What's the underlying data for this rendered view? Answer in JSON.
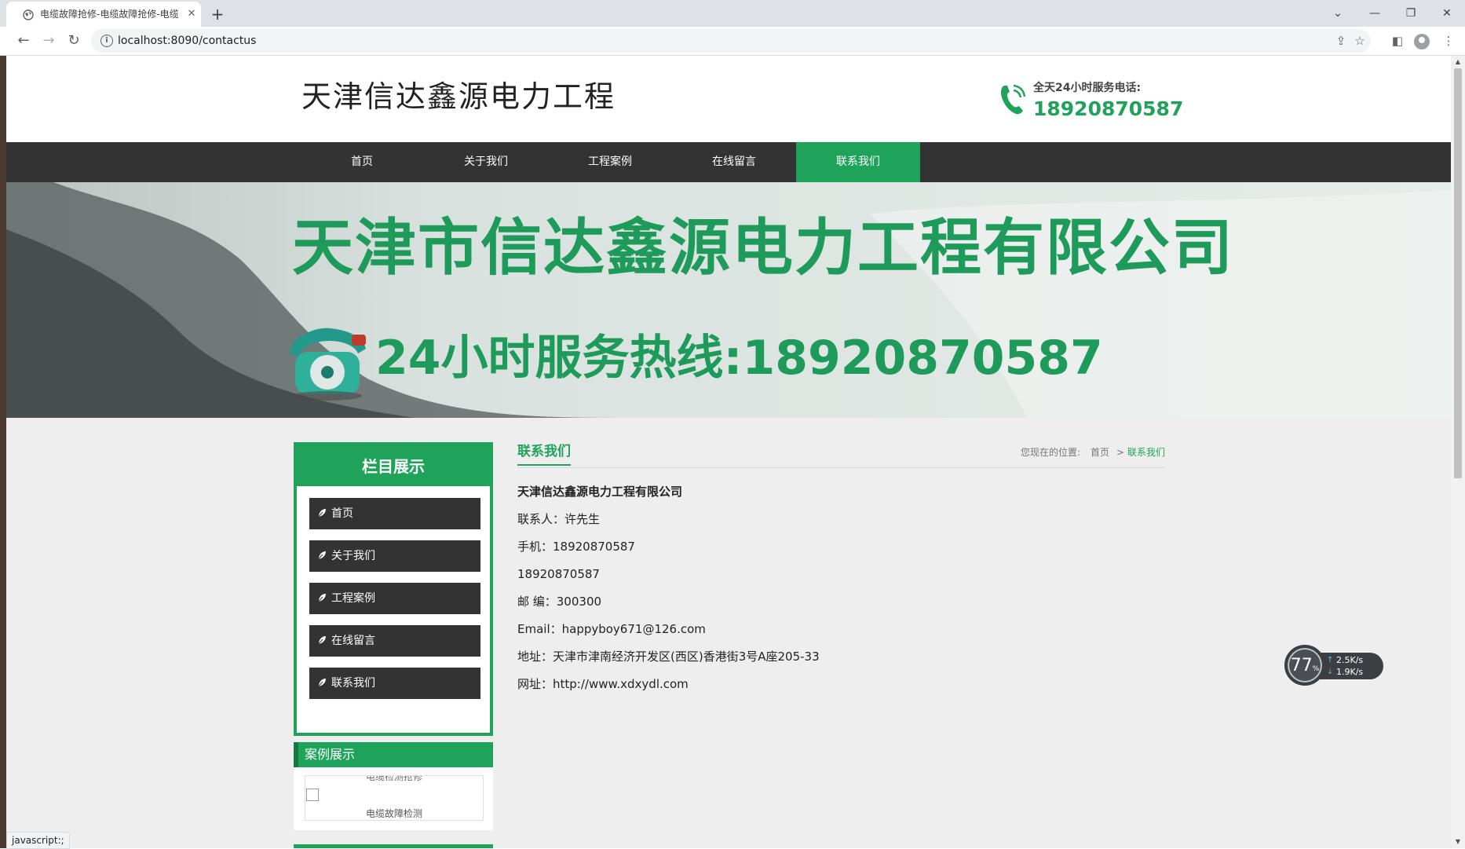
{
  "browser": {
    "tab_title": "电缆故障抢修-电缆故障抢修-电缆",
    "tab_close": "✕",
    "new_tab": "+",
    "url": "localhost:8090/contactus",
    "status_text": "javascript:;",
    "window_controls": {
      "dropdown": "⌄",
      "minimize": "—",
      "restore": "❐",
      "close": "✕"
    }
  },
  "site": {
    "logo": "天津信达鑫源电力工程",
    "hotline_label": "全天24小时服务电话:",
    "hotline_number": "18920870587",
    "accent_color": "#1fa35a",
    "nav": [
      {
        "label": "首页"
      },
      {
        "label": "关于我们"
      },
      {
        "label": "工程案例"
      },
      {
        "label": "在线留言"
      },
      {
        "label": "联系我们",
        "active": true
      }
    ]
  },
  "banner": {
    "title": "天津市信达鑫源电力工程有限公司",
    "hotline": "24小时服务热线:18920870587"
  },
  "sidebar": {
    "heading": "栏目展示",
    "items": [
      {
        "label": "首页"
      },
      {
        "label": "关于我们"
      },
      {
        "label": "工程案例"
      },
      {
        "label": "在线留言"
      },
      {
        "label": "联系我们"
      }
    ],
    "case_heading": "案例展示",
    "case_top_text": "电缆检测抢修",
    "case_caption": "电缆故障检测"
  },
  "content": {
    "title": "联系我们",
    "breadcrumb": {
      "prefix": "您现在的位置:",
      "home": "首页",
      "sep": ">",
      "current": "联系我们"
    },
    "lines": [
      "天津信达鑫源电力工程有限公司",
      "联系人：许先生",
      "手机：18920870587",
      "18920870587",
      "邮 编：300300",
      "Email：happyboy671@126.com",
      "地址：天津市津南经济开发区(西区)香港街3号A座205-33",
      "网址：http://www.xdxydl.com"
    ]
  },
  "speed_widget": {
    "percent": "77",
    "percent_unit": "%",
    "upload": "2.5K/s",
    "download": "1.9K/s"
  }
}
